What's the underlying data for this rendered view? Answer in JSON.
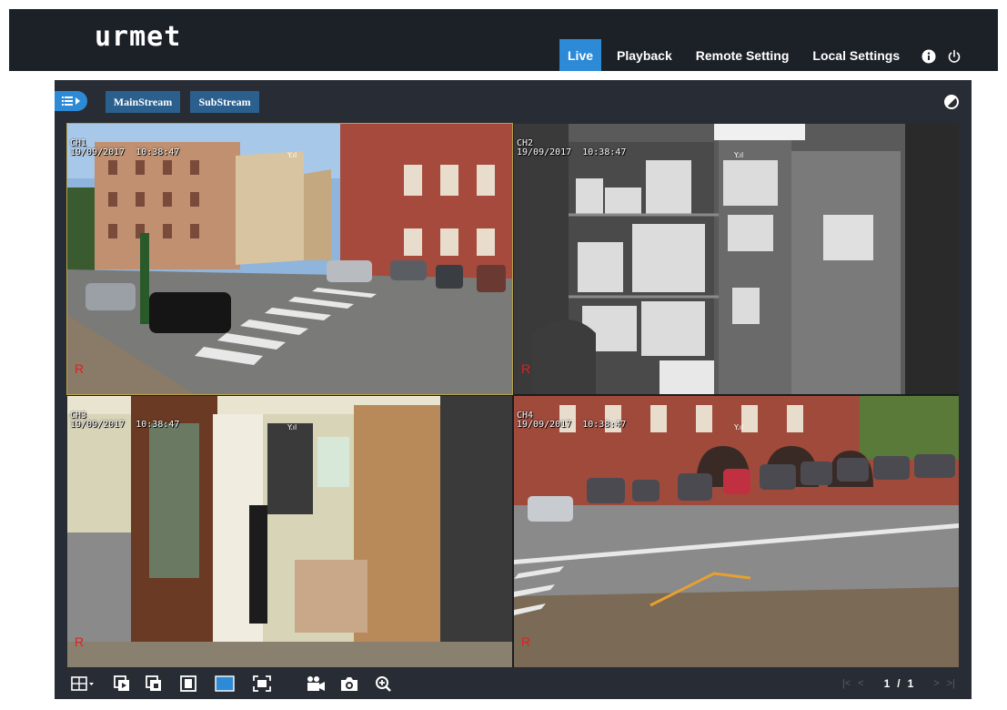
{
  "brand": {
    "logo_text": "urmet"
  },
  "nav": {
    "items": [
      {
        "label": "Live",
        "active": true
      },
      {
        "label": "Playback",
        "active": false
      },
      {
        "label": "Remote Setting",
        "active": false
      },
      {
        "label": "Local Settings",
        "active": false
      }
    ],
    "icons": [
      "info-icon",
      "power-icon"
    ]
  },
  "toolbar": {
    "main_stream_label": "MainStream",
    "sub_stream_label": "SubStream",
    "accent_color": "#2d8ad6",
    "stream_button_color": "#2b5f8e"
  },
  "channels": [
    {
      "name": "CH1",
      "datetime": "19/09/2017  10:38:47",
      "rec": "R",
      "selected": true
    },
    {
      "name": "CH2",
      "datetime": "19/09/2017  10:38:47",
      "rec": "R",
      "selected": false
    },
    {
      "name": "CH3",
      "datetime": "19/09/2017  10:38:47",
      "rec": "R",
      "selected": false
    },
    {
      "name": "CH4",
      "datetime": "19/09/2017  10:38:47",
      "rec": "R",
      "selected": false
    }
  ],
  "pager": {
    "current": "1",
    "separator": "/",
    "total": "1"
  },
  "bottom_icons": [
    "layout-grid-icon",
    "previous-group-icon",
    "next-group-icon",
    "single-view-icon",
    "aspect-ratio-icon",
    "fullscreen-icon",
    "record-icon",
    "snapshot-icon",
    "zoom-icon"
  ]
}
